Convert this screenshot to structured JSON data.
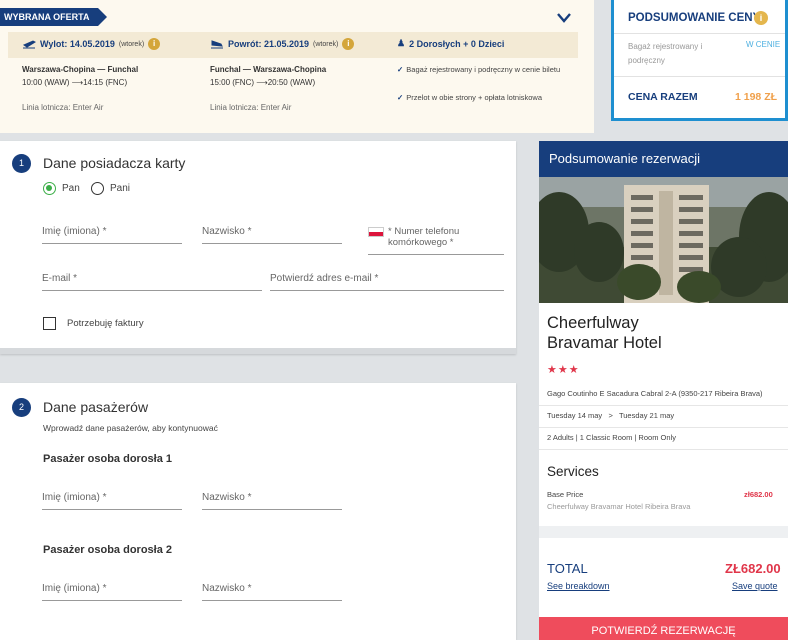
{
  "offer": {
    "tag": "WYBRANA OFERTA",
    "outbound": {
      "label": "Wylot: 14.05.2019",
      "day": "(wtorek)",
      "route": "Warszawa-Chopina — Funchal",
      "times": "10:00 (WAW) ⟶14:15 (FNC)",
      "airline": "Linia lotnicza: Enter Air"
    },
    "return": {
      "label": "Powrót: 21.05.2019",
      "day": "(wtorek)",
      "route": "Funchal — Warszawa-Chopina",
      "times": "15:00 (FNC) ⟶20:50 (WAW)",
      "airline": "Linia lotnicza: Enter Air"
    },
    "passengers": "2 Dorosłych + 0 Dzieci",
    "includes": [
      "Bagaż rejestrowany i podręczny w cenie biletu",
      "Przelot w obie strony + opłata lotniskowa"
    ]
  },
  "price_summary": {
    "title": "PODSUMOWANIE CENY",
    "baggage_label": "Bagaż rejestrowany i podręczny",
    "baggage_value": "W CENIE",
    "total_label": "CENA RAZEM",
    "total_value": "1 198 ZŁ"
  },
  "card_holder": {
    "step": "1",
    "title": "Dane posiadacza karty",
    "salutations": [
      "Pan",
      "Pani"
    ],
    "selected_salutation": "Pan",
    "first_name_label": "Imię (imiona) *",
    "last_name_label": "Nazwisko *",
    "phone_label": "* Numer telefonu komórkowego *",
    "email_label": "E-mail *",
    "email_confirm_label": "Potwierdź adres e-mail *",
    "invoice_label": "Potrzebuję faktury"
  },
  "passengers": {
    "step": "2",
    "title": "Dane pasażerów",
    "instructions": "Wprowadź dane pasażerów, aby kontynuować",
    "items": [
      {
        "title": "Pasażer osoba dorosła 1",
        "first_name_label": "Imię (imiona) *",
        "last_name_label": "Nazwisko *"
      },
      {
        "title": "Pasażer osoba dorosła 2",
        "first_name_label": "Imię (imiona) *",
        "last_name_label": "Nazwisko *"
      }
    ]
  },
  "reservation": {
    "title": "Podsumowanie rezerwacji",
    "hotel_name_line1": "Cheerfulway",
    "hotel_name_line2": "Bravamar Hotel",
    "stars": "★★★",
    "address": "Gago Coutinho E Sacadura Cabral 2-A (9350-217 Ribeira Brava)",
    "date_from": "Tuesday 14 may",
    "date_sep": ">",
    "date_to": "Tuesday 21 may",
    "guests": "2 Adults | 1 Classic Room | Room Only",
    "services_title": "Services",
    "base_price_label": "Base Price",
    "base_price_value": "zł682.00",
    "base_price_hotel": "Cheerfulway Bravamar Hotel Ribeira Brava",
    "total_label": "TOTAL",
    "total_value": "ZŁ682.00",
    "breakdown_link": "See breakdown",
    "save_quote_link": "Save quote",
    "confirm_button": "POTWIERDŹ REZERWACJĘ"
  },
  "colors": {
    "navy": "#173e7d",
    "accent_red": "#ef4c5c",
    "gold": "#d4a63b",
    "green": "#3cae48",
    "light_blue_border": "#1e8fd0"
  }
}
